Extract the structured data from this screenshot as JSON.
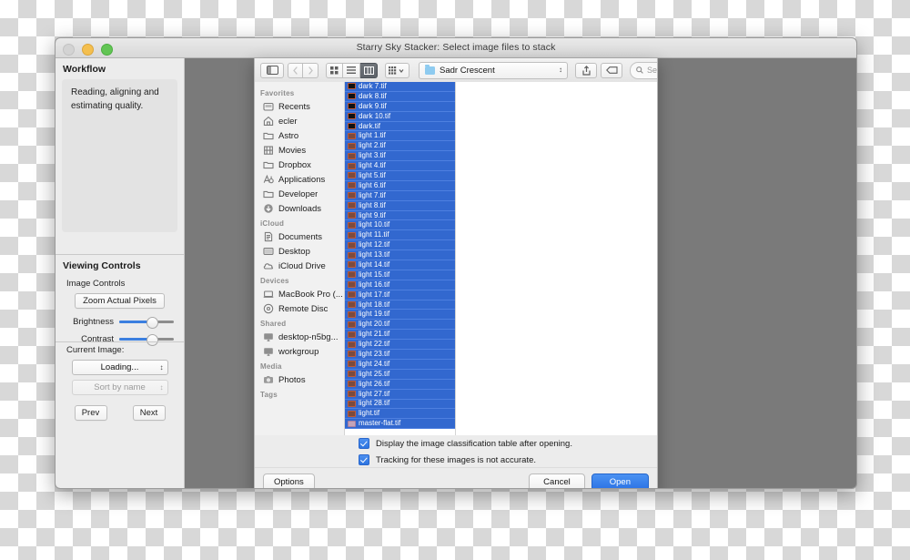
{
  "window": {
    "title": "Starry Sky Stacker: Select image files to stack",
    "traffic_lights": [
      "close-button",
      "minimize-button",
      "zoom-button"
    ]
  },
  "left_panel": {
    "workflow_heading": "Workflow",
    "workflow_text": "Reading, aligning and estimating quality.",
    "viewing_controls_heading": "Viewing Controls",
    "image_controls_label": "Image Controls",
    "zoom_actual_label": "Zoom Actual Pixels",
    "brightness_label": "Brightness",
    "brightness_value": 55,
    "contrast_label": "Contrast",
    "contrast_value": 55,
    "current_image_label": "Current Image:",
    "current_image_value": "Loading...",
    "sort_value": "Sort by name",
    "prev_label": "Prev",
    "next_label": "Next"
  },
  "dialog": {
    "toolbar": {
      "sidebar_toggle": "sidebar-toggle-icon",
      "back": "back-chevron-icon",
      "forward": "forward-chevron-icon",
      "view_icon": "icon-view-icon",
      "view_list": "list-view-icon",
      "view_column": "column-view-icon",
      "arrange": "arrange-grid-icon",
      "share": "share-icon",
      "tag": "tag-icon",
      "path_name": "Sadr Crescent",
      "search_placeholder": "Search"
    },
    "sidebar": [
      {
        "section": "Favorites",
        "items": [
          {
            "label": "Recents",
            "icon": "recents-icon"
          },
          {
            "label": "ecler",
            "icon": "home-icon"
          },
          {
            "label": "Astro",
            "icon": "folder-icon"
          },
          {
            "label": "Movies",
            "icon": "movies-icon"
          },
          {
            "label": "Dropbox",
            "icon": "folder-icon"
          },
          {
            "label": "Applications",
            "icon": "applications-icon"
          },
          {
            "label": "Developer",
            "icon": "folder-icon"
          },
          {
            "label": "Downloads",
            "icon": "downloads-icon"
          }
        ]
      },
      {
        "section": "iCloud",
        "items": [
          {
            "label": "Documents",
            "icon": "documents-icon"
          },
          {
            "label": "Desktop",
            "icon": "desktop-icon"
          },
          {
            "label": "iCloud Drive",
            "icon": "cloud-icon"
          }
        ]
      },
      {
        "section": "Devices",
        "items": [
          {
            "label": "MacBook Pro (...",
            "icon": "laptop-icon"
          },
          {
            "label": "Remote Disc",
            "icon": "disc-icon"
          }
        ]
      },
      {
        "section": "Shared",
        "items": [
          {
            "label": "desktop-n5bg...",
            "icon": "display-icon"
          },
          {
            "label": "workgroup",
            "icon": "display-icon"
          }
        ]
      },
      {
        "section": "Media",
        "items": [
          {
            "label": "Photos",
            "icon": "photos-icon"
          }
        ]
      },
      {
        "section": "Tags",
        "items": []
      }
    ],
    "files": [
      {
        "name": "dark 7.tif",
        "thumb": "#111111"
      },
      {
        "name": "dark 8.tif",
        "thumb": "#111111"
      },
      {
        "name": "dark 9.tif",
        "thumb": "#111111"
      },
      {
        "name": "dark 10.tif",
        "thumb": "#111111"
      },
      {
        "name": "dark.tif",
        "thumb": "#111111"
      },
      {
        "name": "light 1.tif",
        "thumb": "#7d4a3c"
      },
      {
        "name": "light 2.tif",
        "thumb": "#7d4a3c"
      },
      {
        "name": "light 3.tif",
        "thumb": "#7d4a3c"
      },
      {
        "name": "light 4.tif",
        "thumb": "#7d4a3c"
      },
      {
        "name": "light 5.tif",
        "thumb": "#7d4a3c"
      },
      {
        "name": "light 6.tif",
        "thumb": "#7d4a3c"
      },
      {
        "name": "light 7.tif",
        "thumb": "#7d4a3c"
      },
      {
        "name": "light 8.tif",
        "thumb": "#7d4a3c"
      },
      {
        "name": "light 9.tif",
        "thumb": "#7d4a3c"
      },
      {
        "name": "light 10.tif",
        "thumb": "#7d4a3c"
      },
      {
        "name": "light 11.tif",
        "thumb": "#7d4a3c"
      },
      {
        "name": "light 12.tif",
        "thumb": "#7d4a3c"
      },
      {
        "name": "light 13.tif",
        "thumb": "#7d4a3c"
      },
      {
        "name": "light 14.tif",
        "thumb": "#7d4a3c"
      },
      {
        "name": "light 15.tif",
        "thumb": "#7d4a3c"
      },
      {
        "name": "light 16.tif",
        "thumb": "#7d4a3c"
      },
      {
        "name": "light 17.tif",
        "thumb": "#7d4a3c"
      },
      {
        "name": "light 18.tif",
        "thumb": "#7d4a3c"
      },
      {
        "name": "light 19.tif",
        "thumb": "#7d4a3c"
      },
      {
        "name": "light 20.tif",
        "thumb": "#7d4a3c"
      },
      {
        "name": "light 21.tif",
        "thumb": "#7d4a3c"
      },
      {
        "name": "light 22.tif",
        "thumb": "#7d4a3c"
      },
      {
        "name": "light 23.tif",
        "thumb": "#7d4a3c"
      },
      {
        "name": "light 24.tif",
        "thumb": "#7d4a3c"
      },
      {
        "name": "light 25.tif",
        "thumb": "#7d4a3c"
      },
      {
        "name": "light 26.tif",
        "thumb": "#7d4a3c"
      },
      {
        "name": "light 27.tif",
        "thumb": "#7d4a3c"
      },
      {
        "name": "light 28.tif",
        "thumb": "#7d4a3c"
      },
      {
        "name": "light.tif",
        "thumb": "#7d4a3c"
      },
      {
        "name": "master-flat.tif",
        "thumb": "#c3a3b8"
      }
    ],
    "options": [
      {
        "label": "Display the image classification table after opening.",
        "checked": true
      },
      {
        "label": "Tracking for these images is not accurate.",
        "checked": true
      }
    ],
    "footer": {
      "options_label": "Options",
      "cancel_label": "Cancel",
      "open_label": "Open"
    }
  },
  "colors": {
    "selection_blue": "#3268cf",
    "accent_blue": "#2b72e4"
  }
}
